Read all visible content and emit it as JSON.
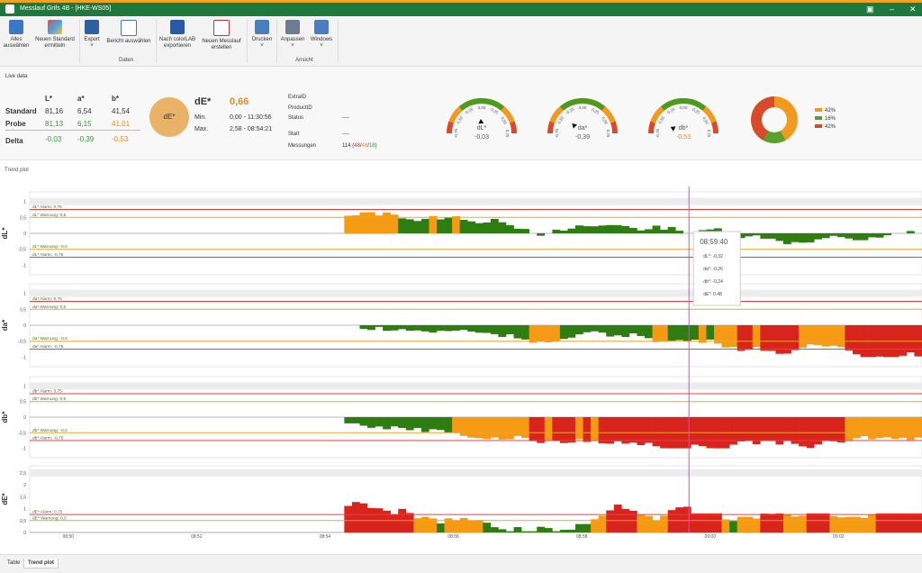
{
  "window": {
    "title": "Messlauf Grifs 4B - [HKE-WS05]"
  },
  "ribbon": {
    "buttons": [
      {
        "label": "Alles auswählen"
      },
      {
        "label": "Neuen Standard ermitteln"
      },
      {
        "label": "Export"
      },
      {
        "label": "Bericht auswählen"
      },
      {
        "label": "Nach colorLAB exportieren"
      },
      {
        "label": "Neuen Messlauf erstellen"
      },
      {
        "label": "Drucken"
      },
      {
        "label": "Anpassen"
      },
      {
        "label": "Windows"
      }
    ],
    "groups": {
      "daten": "Daten",
      "ansicht": "Ansicht"
    }
  },
  "live": {
    "title": "Live data",
    "headers": {
      "l": "L*",
      "a": "a*",
      "b": "b*"
    },
    "rows": {
      "standard": "Standard",
      "probe": "Probe",
      "delta": "Delta"
    },
    "standard": {
      "l": "81,16",
      "a": "6,54",
      "b": "41,54"
    },
    "probe": {
      "l": "81,13",
      "a": "6,15",
      "b": "41,01"
    },
    "delta": {
      "l": "-0,03",
      "a": "-0,39",
      "b": "-0,53"
    },
    "de_circle": "dE*",
    "de_label": "dE*",
    "de_value": "0,66",
    "min_label": "Min.",
    "min_value": "0,00 - 11:30:56",
    "max_label": "Max.",
    "max_value": "2,58 - 08:54:21",
    "fields": {
      "extra": "ExtraID",
      "product": "ProductID",
      "status": "Status",
      "status_val": "----",
      "start": "Start",
      "start_val": "----",
      "messungen": "Messungen",
      "mess_total": "114",
      "mess_a": "48",
      "mess_b": "48",
      "mess_c": "18"
    },
    "gauges": [
      {
        "name": "dL*",
        "value": "-0,03",
        "ticks": [
          "-0,75",
          "-0,50",
          "-0,25",
          "0,00",
          "0,25",
          "0,50",
          "0,75"
        ]
      },
      {
        "name": "da*",
        "value": "-0,39",
        "ticks": [
          "-0,75",
          "-0,50",
          "-0,25",
          "0,00",
          "0,25",
          "0,50",
          "0,75"
        ]
      },
      {
        "name": "db*",
        "value": "-0,53",
        "ticks": [
          "-0,75",
          "-0,50",
          "-0,25",
          "0,00",
          "0,25",
          "0,50",
          "0,75"
        ]
      }
    ],
    "donut": {
      "values": [
        42,
        16,
        42
      ],
      "labels": [
        "42%",
        "16%",
        "42%"
      ],
      "colors": [
        "#f29a1e",
        "#5aa02c",
        "#d94a2a"
      ]
    }
  },
  "trend": {
    "title": "Trend plot"
  },
  "colors": {
    "green": "#2e7d12",
    "orange": "#f59a12",
    "red": "#d9231d",
    "alarm": "#e54040",
    "warn": "#f2a22a",
    "cursor": "#d946d9"
  },
  "chart_data": [
    {
      "type": "bar",
      "ylabel": "dL*",
      "ylim": [
        -1.3,
        1.3
      ],
      "yticks": [
        "1",
        "0,5",
        "0",
        "-0,5",
        "-1"
      ],
      "lines": [
        {
          "label": "dL* Alarm: 0,75",
          "value": 0.75,
          "kind": "alarm"
        },
        {
          "label": "dL* Warnung: 0,5",
          "value": 0.5,
          "kind": "warn"
        },
        {
          "label": "dL* Warnung: -0,5",
          "value": -0.5,
          "kind": "warn"
        },
        {
          "label": "dL* Alarm: -0,75",
          "value": -0.75,
          "kind": "alarm"
        }
      ]
    },
    {
      "type": "bar",
      "ylabel": "da*",
      "ylim": [
        -1.3,
        1.3
      ],
      "yticks": [
        "1",
        "0,5",
        "0",
        "-0,5",
        "-1"
      ],
      "lines": [
        {
          "label": "da* Alarm: 0,75",
          "value": 0.75,
          "kind": "alarm"
        },
        {
          "label": "da* Warnung: 0,5",
          "value": 0.5,
          "kind": "warn"
        },
        {
          "label": "da* Warnung: -0,5",
          "value": -0.5,
          "kind": "warn"
        },
        {
          "label": "da* Alarm: -0,75",
          "value": -0.75,
          "kind": "alarm"
        }
      ]
    },
    {
      "type": "bar",
      "ylabel": "db*",
      "ylim": [
        -1.3,
        1.3
      ],
      "yticks": [
        "1",
        "0,5",
        "0",
        "-0,5",
        "-1"
      ],
      "lines": [
        {
          "label": "db* Alarm: 0,75",
          "value": 0.75,
          "kind": "alarm"
        },
        {
          "label": "db* Warnung: 0,5",
          "value": 0.5,
          "kind": "warn"
        },
        {
          "label": "db* Warnung: -0,5",
          "value": -0.5,
          "kind": "warn"
        },
        {
          "label": "db* Alarm: -0,75",
          "value": -0.75,
          "kind": "alarm"
        }
      ]
    },
    {
      "type": "bar",
      "ylabel": "dE*",
      "ylim": [
        0,
        2.8
      ],
      "yticks": [
        "2,5",
        "2",
        "1,5",
        "1",
        "0,5",
        "0"
      ],
      "lines": [
        {
          "label": "dE* Alarm: 0,75",
          "value": 0.75,
          "kind": "alarm"
        },
        {
          "label": "dE* Warnung: 0,5",
          "value": 0.5,
          "kind": "warn"
        }
      ]
    }
  ],
  "time_axis": {
    "ticks": [
      "08:50",
      "08:52",
      "08:54",
      "08:56",
      "08:58",
      "09:00",
      "09:02"
    ]
  },
  "tooltip": {
    "time": "08:59:40",
    "rows": [
      "dL*: -0,32",
      "da*: -0,26",
      "db*: -0,24",
      "dE*: 0,48"
    ]
  },
  "tabs": {
    "table": "Table",
    "trend": "Trend plot"
  }
}
